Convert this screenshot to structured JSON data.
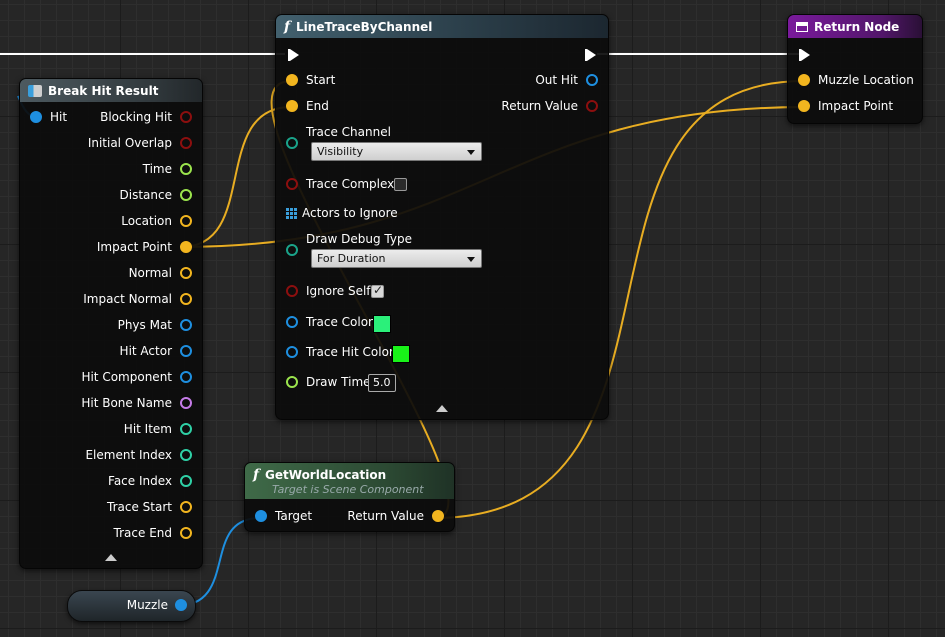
{
  "colors": {
    "exec": "#ffffff",
    "vector": "#f2b51f",
    "bool": "#8c0f0f",
    "float": "#9be44d",
    "object": "#1e8fe0",
    "name": "#c57be8",
    "int": "#2fd0a6",
    "struct": "#1e8fe0",
    "channel": "#1aa38a"
  },
  "nodes": {
    "line_trace": {
      "title": "LineTraceByChannel",
      "icon": "function-icon",
      "inputs": {
        "start": "Start",
        "end": "End",
        "trace_channel": "Trace Channel",
        "trace_channel_value": "Visibility",
        "trace_complex": "Trace Complex",
        "actors_to_ignore": "Actors to Ignore",
        "draw_debug_type": "Draw Debug Type",
        "draw_debug_type_value": "For Duration",
        "ignore_self": "Ignore Self",
        "trace_color": "Trace Color",
        "trace_color_value": "#2bf07a",
        "trace_hit_color": "Trace Hit Color",
        "trace_hit_color_value": "#19f219",
        "draw_time": "Draw Time",
        "draw_time_value": "5.0"
      },
      "outputs": {
        "out_hit": "Out Hit",
        "return_value": "Return Value"
      },
      "trace_complex_checked": false,
      "ignore_self_checked": true
    },
    "return_node": {
      "title": "Return Node",
      "icon": "return-node-icon",
      "inputs": {
        "muzzle_location": "Muzzle Location",
        "impact_point": "Impact Point"
      }
    },
    "break_hit_result": {
      "title": "Break Hit Result",
      "icon": "break-struct-icon",
      "input": "Hit",
      "outputs": [
        {
          "label": "Blocking Hit",
          "type": "bool"
        },
        {
          "label": "Initial Overlap",
          "type": "bool"
        },
        {
          "label": "Time",
          "type": "float"
        },
        {
          "label": "Distance",
          "type": "float"
        },
        {
          "label": "Location",
          "type": "vector"
        },
        {
          "label": "Impact Point",
          "type": "vector"
        },
        {
          "label": "Normal",
          "type": "vector"
        },
        {
          "label": "Impact Normal",
          "type": "vector"
        },
        {
          "label": "Phys Mat",
          "type": "object"
        },
        {
          "label": "Hit Actor",
          "type": "object"
        },
        {
          "label": "Hit Component",
          "type": "object"
        },
        {
          "label": "Hit Bone Name",
          "type": "name"
        },
        {
          "label": "Hit Item",
          "type": "int"
        },
        {
          "label": "Element Index",
          "type": "int"
        },
        {
          "label": "Face Index",
          "type": "int"
        },
        {
          "label": "Trace Start",
          "type": "vector"
        },
        {
          "label": "Trace End",
          "type": "vector"
        }
      ]
    },
    "get_world_location": {
      "title": "GetWorldLocation",
      "subtitle": "Target is Scene Component",
      "icon": "function-icon",
      "input": "Target",
      "output": "Return Value"
    },
    "muzzle_var": {
      "label": "Muzzle"
    }
  }
}
